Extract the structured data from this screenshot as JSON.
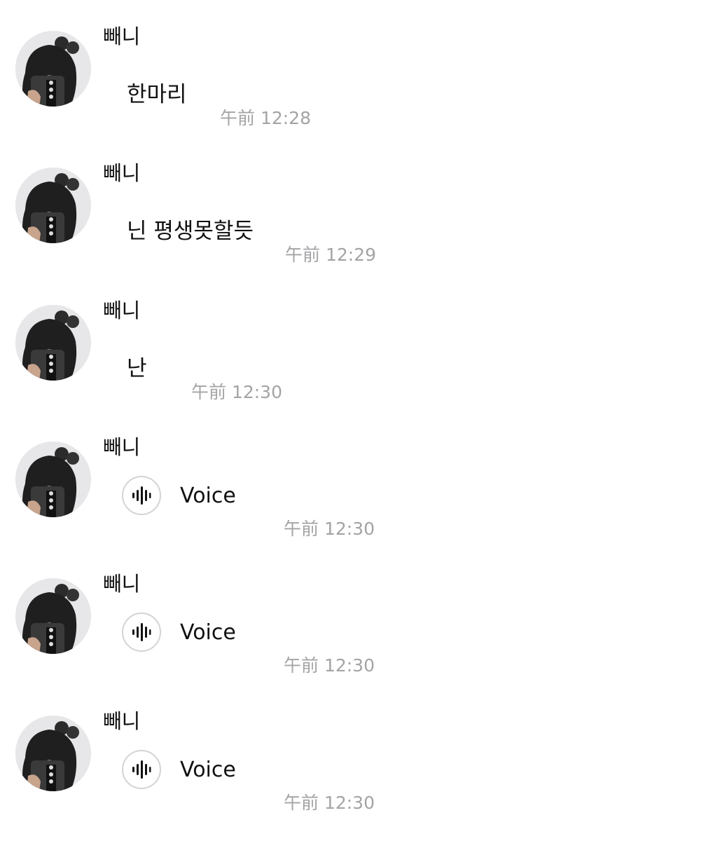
{
  "messages": [
    {
      "sender": "빼니",
      "text": "한마리",
      "time": "午前 12:28"
    },
    {
      "sender": "빼니",
      "text": "닌 평생못할듯",
      "time": "午前 12:29"
    },
    {
      "sender": "빼니",
      "text": "난",
      "time": "午前 12:30"
    },
    {
      "sender": "빼니",
      "voice_label": "Voice",
      "time": "午前 12:30"
    },
    {
      "sender": "빼니",
      "voice_label": "Voice",
      "time": "午前 12:30"
    },
    {
      "sender": "빼니",
      "voice_label": "Voice",
      "time": "午前 12:30"
    }
  ],
  "icons": {
    "voice": "waveform-icon",
    "avatar": "profile-photo"
  },
  "colors": {
    "background": "#ffffff",
    "text": "#111111",
    "timestamp": "#a4a4a7",
    "voice_button_border": "#d4d4d6"
  }
}
